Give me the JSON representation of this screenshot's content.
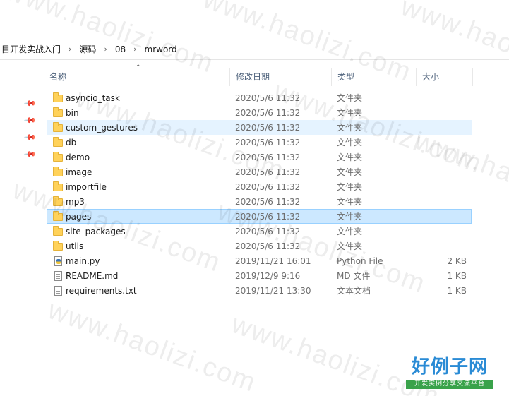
{
  "watermark": {
    "text": "www.haolizi.com",
    "logo_text": "好例子网",
    "logo_subtext": "开发实例分享交流平台"
  },
  "breadcrumb": [
    "目开发实战入门",
    "源码",
    "08",
    "mrword"
  ],
  "columns": {
    "name": "名称",
    "date": "修改日期",
    "type": "类型",
    "size": "大小"
  },
  "files": [
    {
      "name": "asyncio_task",
      "date": "2020/5/6 11:32",
      "type": "文件夹",
      "size": "",
      "icon": "folder-icon",
      "state": ""
    },
    {
      "name": "bin",
      "date": "2020/5/6 11:32",
      "type": "文件夹",
      "size": "",
      "icon": "folder-icon",
      "state": ""
    },
    {
      "name": "custom_gestures",
      "date": "2020/5/6 11:32",
      "type": "文件夹",
      "size": "",
      "icon": "folder-icon",
      "state": "hover"
    },
    {
      "name": "db",
      "date": "2020/5/6 11:32",
      "type": "文件夹",
      "size": "",
      "icon": "folder-icon",
      "state": ""
    },
    {
      "name": "demo",
      "date": "2020/5/6 11:32",
      "type": "文件夹",
      "size": "",
      "icon": "folder-icon",
      "state": ""
    },
    {
      "name": "image",
      "date": "2020/5/6 11:32",
      "type": "文件夹",
      "size": "",
      "icon": "folder-icon",
      "state": ""
    },
    {
      "name": "importfile",
      "date": "2020/5/6 11:32",
      "type": "文件夹",
      "size": "",
      "icon": "folder-icon",
      "state": ""
    },
    {
      "name": "mp3",
      "date": "2020/5/6 11:32",
      "type": "文件夹",
      "size": "",
      "icon": "folder-icon",
      "state": ""
    },
    {
      "name": "pages",
      "date": "2020/5/6 11:32",
      "type": "文件夹",
      "size": "",
      "icon": "folder-icon",
      "state": "selected"
    },
    {
      "name": "site_packages",
      "date": "2020/5/6 11:32",
      "type": "文件夹",
      "size": "",
      "icon": "folder-icon",
      "state": ""
    },
    {
      "name": "utils",
      "date": "2020/5/6 11:32",
      "type": "文件夹",
      "size": "",
      "icon": "folder-icon",
      "state": ""
    },
    {
      "name": "main.py",
      "date": "2019/11/21 16:01",
      "type": "Python File",
      "size": "2 KB",
      "icon": "python-file-icon",
      "state": ""
    },
    {
      "name": "README.md",
      "date": "2019/12/9 9:16",
      "type": "MD 文件",
      "size": "1 KB",
      "icon": "file-icon",
      "state": ""
    },
    {
      "name": "requirements.txt",
      "date": "2019/11/21 13:30",
      "type": "文本文档",
      "size": "1 KB",
      "icon": "text-file-icon",
      "state": ""
    }
  ],
  "colors": {
    "hover_row": "#e5f3ff",
    "selected_row": "#cce8ff",
    "folder": "#ffd25a",
    "header_text": "#4c607a"
  }
}
